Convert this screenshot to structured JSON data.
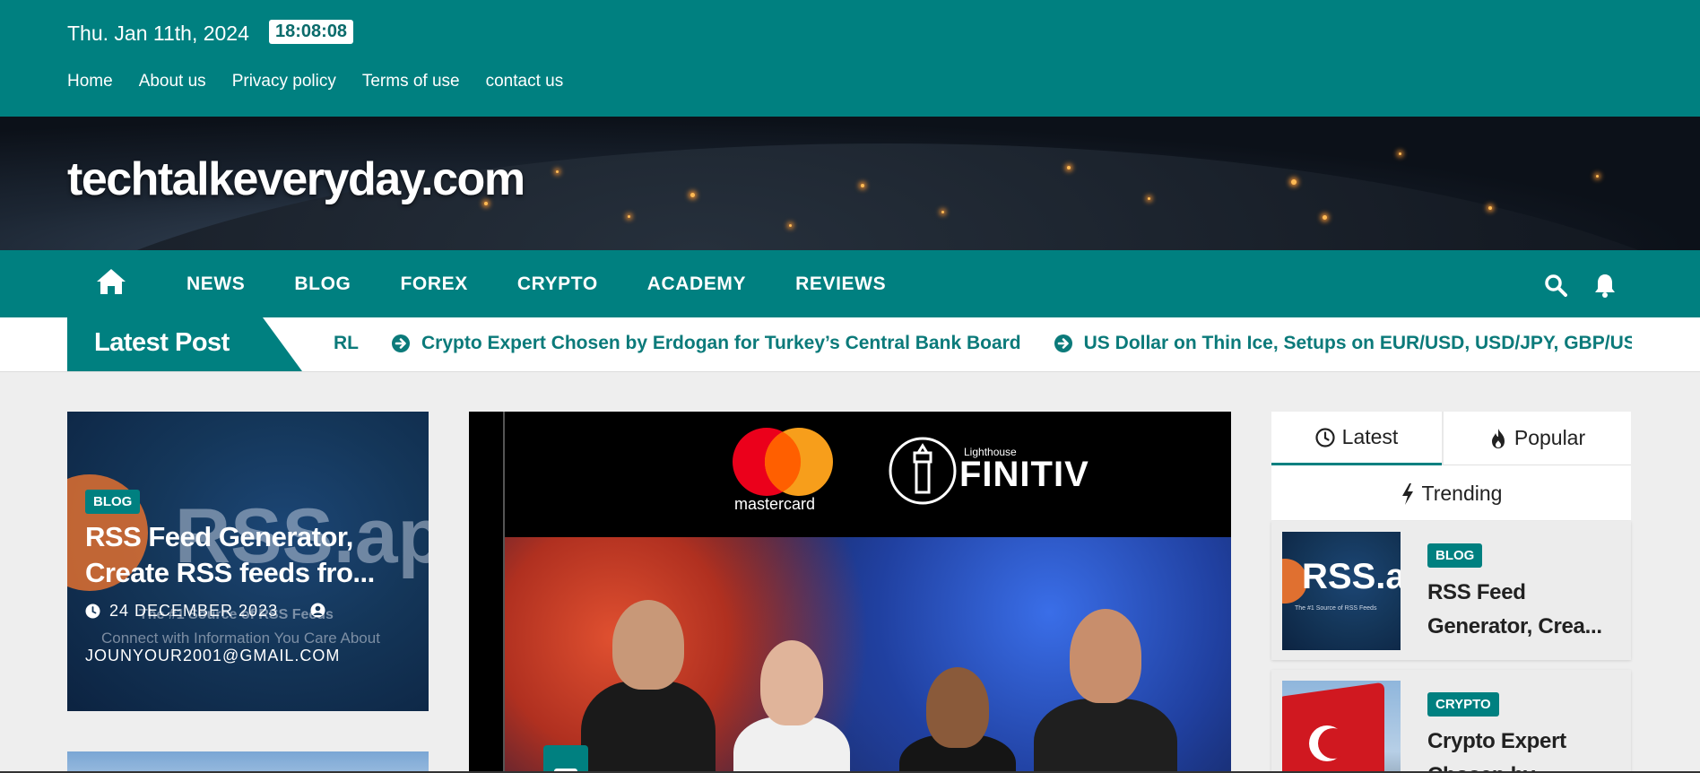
{
  "topbar": {
    "date": "Thu. Jan 11th, 2024",
    "time": "18:08:08",
    "links": [
      "Home",
      "About us",
      "Privacy policy",
      "Terms of use",
      "contact us"
    ]
  },
  "site": {
    "title": "techtalkeveryday.com"
  },
  "nav": {
    "items": [
      "NEWS",
      "BLOG",
      "FOREX",
      "CRYPTO",
      "ACADEMY",
      "REVIEWS"
    ],
    "icons": [
      "home-icon",
      "search-icon",
      "bell-icon"
    ]
  },
  "ticker": {
    "label": "Latest Post",
    "items": [
      "RL",
      "Crypto Expert Chosen by Erdogan for Turkey’s Central Bank Board",
      "US Dollar on Thin Ice, Setups on EUR/USD, USD/JPY, GBP/US"
    ]
  },
  "featured_left": {
    "image_text": "RSS.app",
    "image_sub1": "The #1 Source of RSS Feeds",
    "image_sub2": "Connect with Information You Care About",
    "category": "BLOG",
    "title": "RSS Feed Generator, Create RSS feeds fro...",
    "date": "24 DECEMBER 2023",
    "author": "JOUNYOUR2001@GMAIL.COM"
  },
  "featured_center": {
    "logo1": "mastercard",
    "logo2_small": "Lighthouse",
    "logo2_big": "FINITIV"
  },
  "sidebar": {
    "tabs": [
      "Latest",
      "Popular",
      "Trending"
    ],
    "posts": [
      {
        "category": "BLOG",
        "title": "RSS Feed Generator, Crea...",
        "thumb_text": "RSS.ap",
        "thumb_sub": "The #1 Source of RSS Feeds"
      },
      {
        "category": "CRYPTO",
        "title": "Crypto Expert Chosen by..."
      }
    ]
  },
  "colors": {
    "accent": "#008080",
    "ticker_text": "#0b7a7a",
    "background": "#eeeeee"
  }
}
